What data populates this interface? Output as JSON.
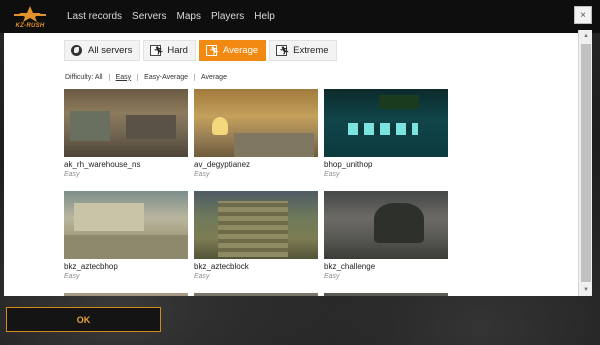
{
  "brand": {
    "logo_text": "KZ-RUSH"
  },
  "nav": {
    "items": [
      "Last records",
      "Servers",
      "Maps",
      "Players",
      "Help"
    ]
  },
  "window": {
    "close_label": "×"
  },
  "tabs": [
    {
      "label": "All servers",
      "icon": "globe-icon",
      "active": false
    },
    {
      "label": "Hard",
      "icon": "runner-icon",
      "active": false
    },
    {
      "label": "Average",
      "icon": "runner-icon",
      "active": true
    },
    {
      "label": "Extreme",
      "icon": "runner-icon",
      "active": false
    }
  ],
  "filter": {
    "label": "Difficulty: All",
    "options": [
      "Easy",
      "Easy-Average",
      "Average"
    ]
  },
  "maps": [
    {
      "name": "ak_rh_warehouse_ns",
      "difficulty": "Easy"
    },
    {
      "name": "av_degyptianez",
      "difficulty": "Easy"
    },
    {
      "name": "bhop_unithop",
      "difficulty": "Easy"
    },
    {
      "name": "bkz_aztecbhop",
      "difficulty": "Easy"
    },
    {
      "name": "bkz_aztecblock",
      "difficulty": "Easy"
    },
    {
      "name": "bkz_challenge",
      "difficulty": "Easy"
    }
  ],
  "footer": {
    "ok_label": "OK"
  },
  "colors": {
    "accent": "#f28a12",
    "panel": "#ffffff",
    "dark": "#0e0e0e"
  }
}
